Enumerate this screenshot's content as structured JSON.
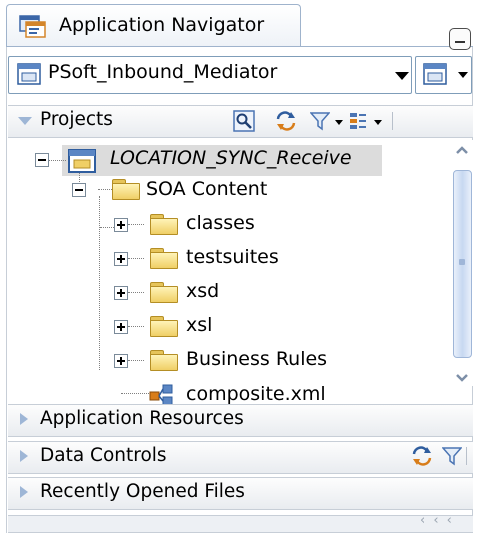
{
  "navigator": {
    "tab_label": "Application Navigator",
    "icon": "application-navigator-icon"
  },
  "application": {
    "selected": "PSoft_Inbound_Mediator"
  },
  "projects_panel": {
    "label": "Projects",
    "tree": {
      "project": "LOCATION_SYNC_Receive",
      "soa_content": "SOA Content",
      "folders": [
        "classes",
        "testsuites",
        "xsd",
        "xsl",
        "Business Rules"
      ],
      "file": "composite.xml"
    }
  },
  "sections": {
    "app_resources": "Application Resources",
    "data_controls": "Data Controls",
    "recent_files": "Recently Opened Files"
  },
  "status": {
    "glyph": "‹ ‹ ‹"
  },
  "colors": {
    "accent": "#9eb6d6",
    "folder": "#f0cf66",
    "selection": "#dcdcdc"
  }
}
